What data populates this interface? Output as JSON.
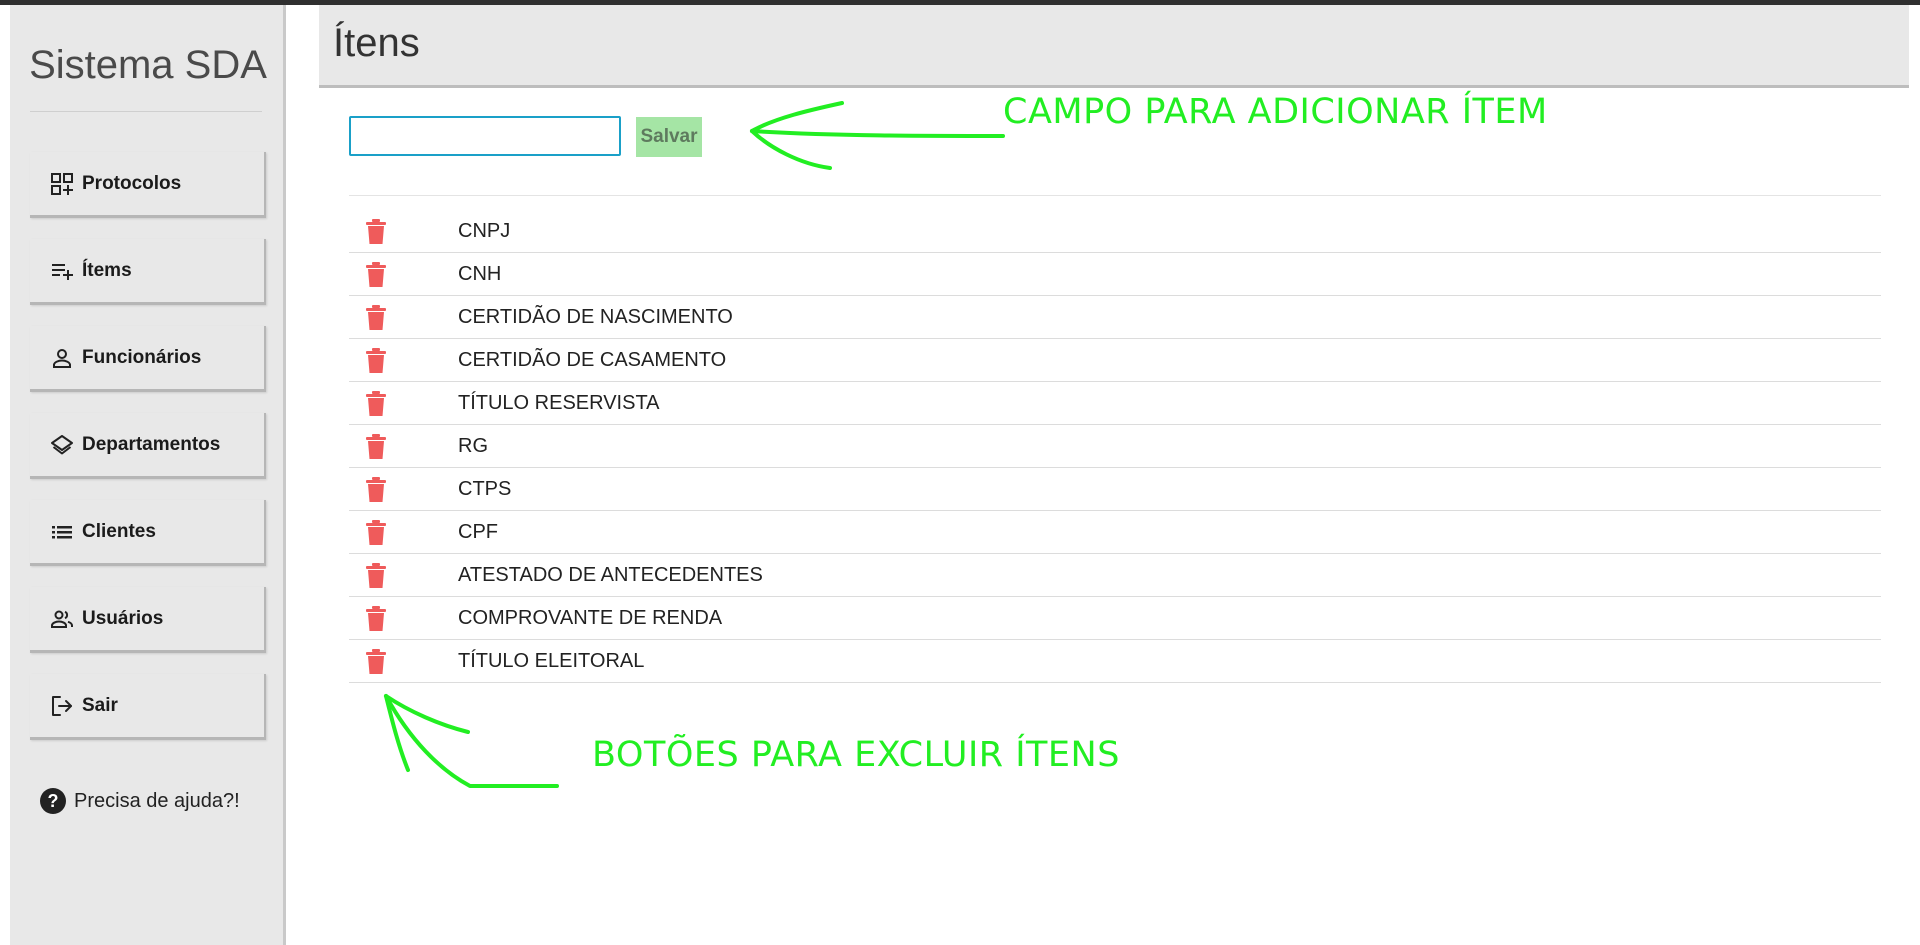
{
  "sidebar": {
    "brand": "Sistema SDA",
    "items": [
      {
        "label": "Protocolos",
        "icon": "dashboard-add-icon"
      },
      {
        "label": "Ítems",
        "icon": "playlist-add-icon"
      },
      {
        "label": "Funcionários",
        "icon": "person-icon"
      },
      {
        "label": "Departamentos",
        "icon": "layers-icon"
      },
      {
        "label": "Clientes",
        "icon": "list-icon"
      },
      {
        "label": "Usuários",
        "icon": "people-icon"
      },
      {
        "label": "Sair",
        "icon": "logout-icon"
      }
    ],
    "help": {
      "label": "Precisa de ajuda?!",
      "icon": "question-circle-icon"
    }
  },
  "page": {
    "title": "Ítens"
  },
  "form": {
    "input_value": "",
    "save_label": "Salvar"
  },
  "items": [
    "CNPJ",
    "CNH",
    "CERTIDÃO DE NASCIMENTO",
    "CERTIDÃO DE CASAMENTO",
    "TÍTULO RESERVISTA",
    "RG",
    "CTPS",
    "CPF",
    "ATESTADO DE ANTECEDENTES",
    "COMPROVANTE DE RENDA",
    "TÍTULO ELEITORAL"
  ],
  "annotations": {
    "add_field": "CAMPO PARA ADICIONAR ÍTEM",
    "delete_buttons": "BOTÕES PARA EXCLUIR ÍTENS"
  },
  "colors": {
    "trash": "#ef5b5b",
    "annotation": "#22ee22",
    "save_button_bg": "#a5e5a5",
    "input_border": "#1aa0c8"
  }
}
